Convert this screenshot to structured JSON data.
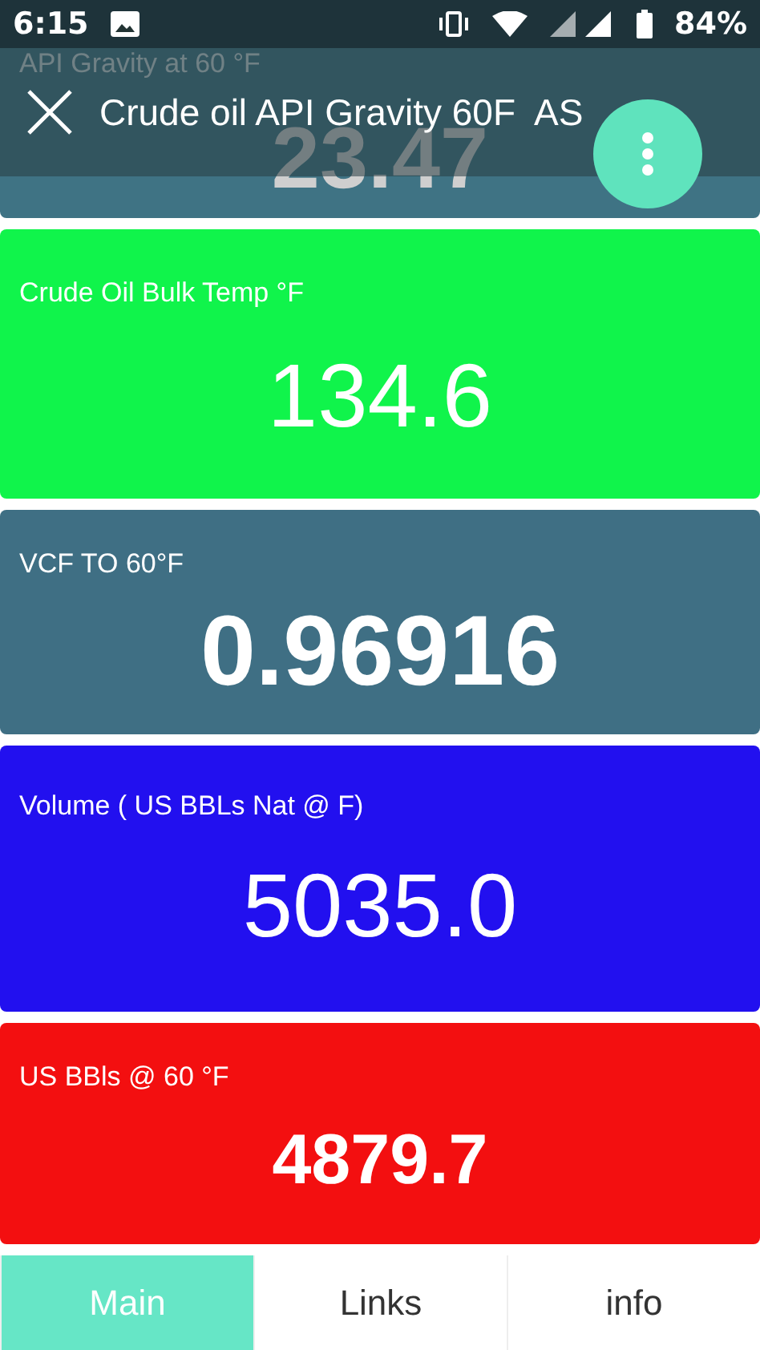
{
  "status_bar": {
    "time": "6:15",
    "battery": "84%"
  },
  "app_bar": {
    "title": "Crude oil API Gravity 60F  AS"
  },
  "cards": [
    {
      "label": "API Gravity at 60 °F",
      "value": "23.47",
      "color": "#3f7384",
      "bold": true
    },
    {
      "label": "Crude Oil Bulk Temp °F",
      "value": "134.6",
      "color": "#10f44b",
      "bold": false
    },
    {
      "label": "VCF TO 60°F",
      "value": "0.96916",
      "color": "#3f6f84",
      "bold": true
    },
    {
      "label": "Volume ( US BBLs  Nat @ F)",
      "value": "5035.0",
      "color": "#2210ef",
      "bold": false
    },
    {
      "label": "US BBls @ 60 °F",
      "value": "4879.7",
      "color": "#f30f10",
      "bold": true
    }
  ],
  "tabs": [
    {
      "label": "Main",
      "selected": true
    },
    {
      "label": "Links",
      "selected": false
    },
    {
      "label": "info",
      "selected": false
    }
  ]
}
